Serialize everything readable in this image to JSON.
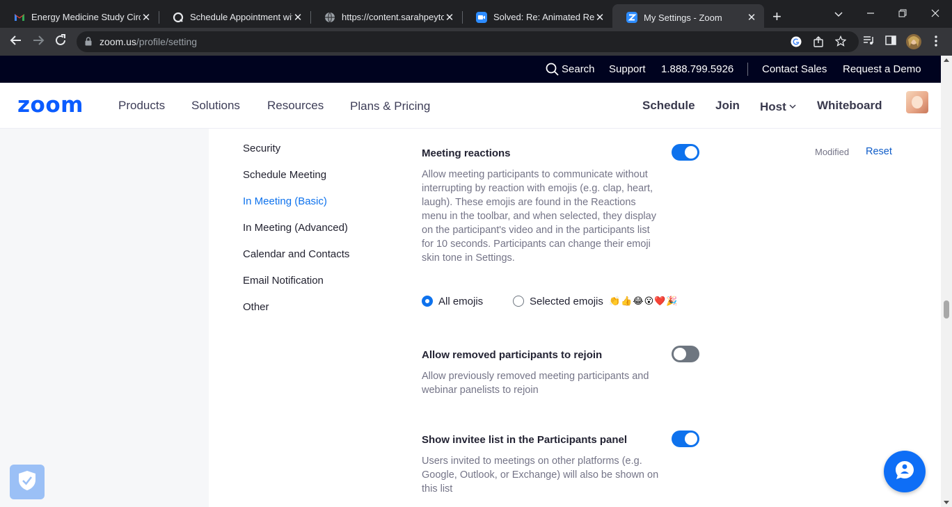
{
  "browser": {
    "tabs": [
      {
        "title": "Energy Medicine Study Circle",
        "icon": "gmail-icon"
      },
      {
        "title": "Schedule Appointment with Sarah",
        "icon": "scheduling-icon"
      },
      {
        "title": "https://content.sarahpeyton.com",
        "icon": "globe-icon"
      },
      {
        "title": "Solved: Re: Animated Reactions",
        "icon": "zoom-video-icon"
      },
      {
        "title": "My Settings - Zoom",
        "icon": "zoom-icon"
      }
    ],
    "url_host": "zoom.us",
    "url_path": "/profile/setting"
  },
  "topstrip": {
    "search": "Search",
    "support": "Support",
    "phone": "1.888.799.5926",
    "contact_sales": "Contact Sales",
    "request_demo": "Request a Demo"
  },
  "nav": {
    "logo": "zoom",
    "products": "Products",
    "solutions": "Solutions",
    "resources": "Resources",
    "plans": "Plans & Pricing",
    "schedule": "Schedule",
    "join": "Join",
    "host": "Host",
    "whiteboard": "Whiteboard"
  },
  "sidenav": {
    "items": [
      "Security",
      "Schedule Meeting",
      "In Meeting (Basic)",
      "In Meeting (Advanced)",
      "Calendar and Contacts",
      "Email Notification",
      "Other"
    ],
    "active": "In Meeting (Basic)"
  },
  "settings": {
    "reactions": {
      "title": "Meeting reactions",
      "description": "Allow meeting participants to communicate without interrupting by reaction with emojis (e.g. clap, heart, laugh). These emojis are found in the Reactions menu in the toolbar, and when selected, they display on the participant's video and in the participants list for 10 seconds. Participants can change their emoji skin tone in Settings.",
      "enabled": true,
      "modified": "Modified",
      "reset": "Reset",
      "option_all": "All emojis",
      "option_selected": "Selected emojis",
      "selected_emojis": "👏👍😂😮❤️🎉",
      "selected_option": "All emojis"
    },
    "rejoin": {
      "title": "Allow removed participants to rejoin",
      "description": "Allow previously removed meeting participants and webinar panelists to rejoin",
      "enabled": false
    },
    "invitee": {
      "title": "Show invitee list in the Participants panel",
      "description": "Users invited to meetings on other platforms (e.g. Google, Outlook, or Exchange) will also be shown on this list",
      "enabled": true
    }
  },
  "colors": {
    "brand": "#0b5cff",
    "toggle_on": "#0e72ed",
    "topbar": "#00031f"
  }
}
